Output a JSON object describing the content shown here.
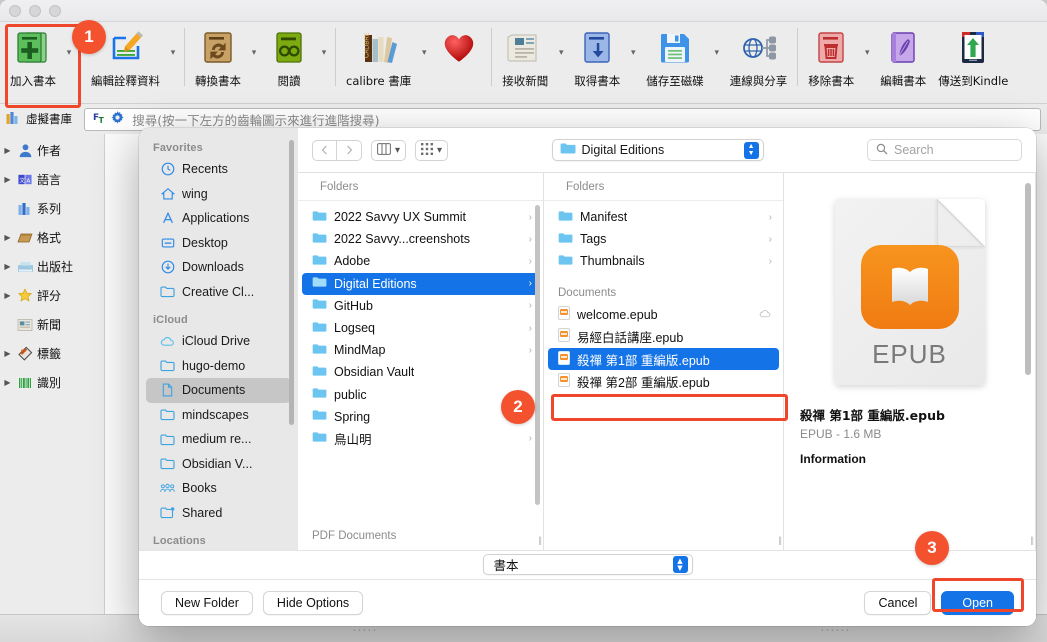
{
  "window": {
    "traffic_lights": [
      "close",
      "minimize",
      "maximize"
    ]
  },
  "toolbar": {
    "items": [
      {
        "label": "加入書本",
        "icon": "add-book-icon",
        "caret": true
      },
      {
        "label": "編輯詮釋資料",
        "icon": "edit-metadata-icon",
        "caret": true
      },
      {
        "label": "轉換書本",
        "icon": "convert-book-icon",
        "caret": true
      },
      {
        "label": "閱讀",
        "icon": "read-icon",
        "caret": true
      },
      {
        "label": "calibre 書庫",
        "icon": "calibre-library-icon",
        "caret": true
      },
      {
        "label": "",
        "icon": "heart-icon",
        "caret": false
      },
      {
        "label": "接收新聞",
        "icon": "fetch-news-icon",
        "caret": true
      },
      {
        "label": "取得書本",
        "icon": "get-books-icon",
        "caret": true
      },
      {
        "label": "儲存至磁碟",
        "icon": "save-to-disk-icon",
        "caret": true
      },
      {
        "label": "連線與分享",
        "icon": "connect-share-icon",
        "caret": false
      },
      {
        "label": "移除書本",
        "icon": "remove-books-icon",
        "caret": true
      },
      {
        "label": "編輯書本",
        "icon": "edit-book-icon",
        "caret": false
      },
      {
        "label": "傳送到Kindle",
        "icon": "send-to-kindle-icon",
        "caret": false
      }
    ]
  },
  "search": {
    "virtual_library_label": "虛擬書庫",
    "placeholder": "搜尋(按一下左方的齒輪圖示來進行進階搜尋)",
    "value": ""
  },
  "categories": {
    "items": [
      {
        "label": "作者",
        "icon": "author-icon",
        "expandable": true
      },
      {
        "label": "語言",
        "icon": "language-icon",
        "expandable": true
      },
      {
        "label": "系列",
        "icon": "series-icon",
        "expandable": false
      },
      {
        "label": "格式",
        "icon": "format-icon",
        "expandable": true
      },
      {
        "label": "出版社",
        "icon": "publisher-icon",
        "expandable": true
      },
      {
        "label": "評分",
        "icon": "rating-icon",
        "expandable": true
      },
      {
        "label": "新聞",
        "icon": "news-icon",
        "expandable": false
      },
      {
        "label": "標籤",
        "icon": "tags-icon",
        "expandable": true
      },
      {
        "label": "識別",
        "icon": "identifiers-icon",
        "expandable": true
      }
    ]
  },
  "dialog": {
    "sidebar": {
      "sections": [
        {
          "title": "Favorites",
          "items": [
            {
              "label": "Recents",
              "icon": "clock-icon",
              "selected": false
            },
            {
              "label": "wing",
              "icon": "home-icon",
              "selected": false
            },
            {
              "label": "Applications",
              "icon": "applications-icon",
              "selected": false
            },
            {
              "label": "Desktop",
              "icon": "desktop-icon",
              "selected": false
            },
            {
              "label": "Downloads",
              "icon": "downloads-icon",
              "selected": false
            },
            {
              "label": "Creative Cl...",
              "icon": "folder-icon",
              "selected": false
            }
          ]
        },
        {
          "title": "iCloud",
          "items": [
            {
              "label": "iCloud Drive",
              "icon": "cloud-icon",
              "selected": false
            },
            {
              "label": "hugo-demo",
              "icon": "folder-icon",
              "selected": false
            },
            {
              "label": "Documents",
              "icon": "document-icon",
              "selected": true
            },
            {
              "label": "mindscapes",
              "icon": "folder-icon",
              "selected": false
            },
            {
              "label": "medium re...",
              "icon": "folder-icon",
              "selected": false
            },
            {
              "label": "Obsidian V...",
              "icon": "folder-icon",
              "selected": false
            },
            {
              "label": "Books",
              "icon": "shared-people-icon",
              "selected": false
            },
            {
              "label": "Shared",
              "icon": "shared-folder-icon",
              "selected": false
            }
          ]
        },
        {
          "title": "Locations",
          "items": []
        }
      ]
    },
    "toolbar": {
      "back_icon": "chevron-left-icon",
      "forward_icon": "chevron-right-icon",
      "view_mode_icon": "column-view-icon",
      "group_icon": "group-by-icon",
      "path_label": "Digital Editions",
      "search_placeholder": "Search",
      "search_value": ""
    },
    "column1": {
      "header": "Folders",
      "footer": "PDF Documents",
      "rows": [
        {
          "label": "2022 Savvy UX Summit",
          "chevron": true,
          "selected": false,
          "cloud": false
        },
        {
          "label": "2022 Savvy...creenshots",
          "chevron": true,
          "selected": false,
          "cloud": false
        },
        {
          "label": "Adobe",
          "chevron": true,
          "selected": false,
          "cloud": false
        },
        {
          "label": "Digital Editions",
          "chevron": true,
          "selected": true,
          "cloud": false
        },
        {
          "label": "GitHub",
          "chevron": true,
          "selected": false,
          "cloud": false
        },
        {
          "label": "Logseq",
          "chevron": true,
          "selected": false,
          "cloud": false
        },
        {
          "label": "MindMap",
          "chevron": true,
          "selected": false,
          "cloud": false
        },
        {
          "label": "Obsidian Vault",
          "chevron": false,
          "selected": false,
          "cloud": false
        },
        {
          "label": "public",
          "chevron": false,
          "selected": false,
          "cloud": false
        },
        {
          "label": "Spring",
          "chevron": true,
          "selected": false,
          "cloud": true
        },
        {
          "label": "鳥山明",
          "chevron": true,
          "selected": false,
          "cloud": false
        }
      ]
    },
    "column2": {
      "header": "Folders",
      "group_label": "Documents",
      "folders": [
        {
          "label": "Manifest",
          "chevron": true
        },
        {
          "label": "Tags",
          "chevron": true
        },
        {
          "label": "Thumbnails",
          "chevron": true
        }
      ],
      "files": [
        {
          "label": "welcome.epub",
          "selected": false,
          "cloud": true
        },
        {
          "label": "易經白話講座.epub",
          "selected": false,
          "cloud": false
        },
        {
          "label": "殺禪 第1部 重編版.epub",
          "selected": true,
          "cloud": false
        },
        {
          "label": "殺禪 第2部 重編版.epub",
          "selected": false,
          "cloud": false
        }
      ]
    },
    "preview": {
      "doc_type_label": "EPUB",
      "file_name": "殺禪 第1部 重編版.epub",
      "meta": "EPUB - 1.6 MB",
      "info_header": "Information"
    },
    "format_popup": {
      "value": "書本"
    },
    "buttons": {
      "new_folder": "New Folder",
      "hide_options": "Hide Options",
      "cancel": "Cancel",
      "open": "Open"
    }
  },
  "annotations": {
    "badges": [
      {
        "number": "1",
        "target": "add-book-button"
      },
      {
        "number": "2",
        "target": "selected-epub-file"
      },
      {
        "number": "3",
        "target": "open-button"
      }
    ],
    "highlight_color": "#f4522f",
    "accent_color": "#1473e6"
  }
}
